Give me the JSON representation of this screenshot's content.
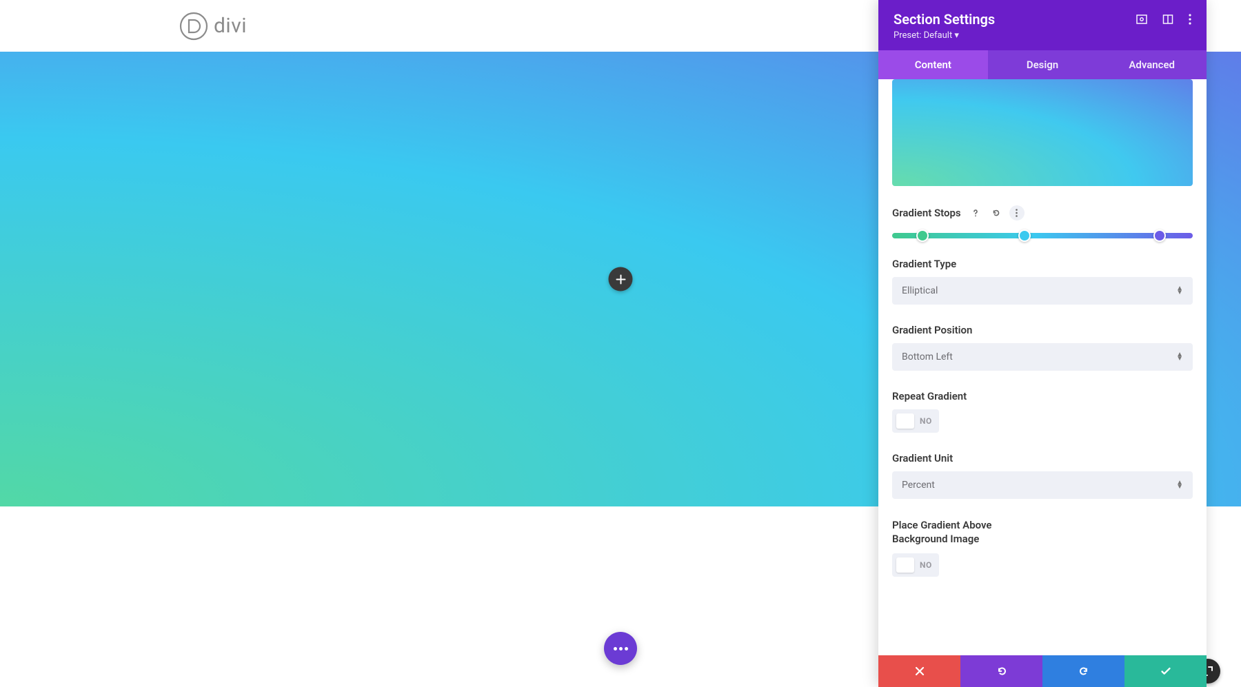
{
  "brand": {
    "name": "divi"
  },
  "panel": {
    "title": "Section Settings",
    "preset": "Preset: Default ▾",
    "tabs": {
      "content": "Content",
      "design": "Design",
      "advanced": "Advanced"
    },
    "gradient_stops": {
      "label": "Gradient Stops",
      "stops": [
        {
          "pos": 10,
          "color": "#3fc98e"
        },
        {
          "pos": 44,
          "color": "#3bc9ef"
        },
        {
          "pos": 89,
          "color": "#6c5ce7"
        }
      ]
    },
    "gradient_type": {
      "label": "Gradient Type",
      "value": "Elliptical"
    },
    "gradient_position": {
      "label": "Gradient Position",
      "value": "Bottom Left"
    },
    "repeat_gradient": {
      "label": "Repeat Gradient",
      "value": "NO"
    },
    "gradient_unit": {
      "label": "Gradient Unit",
      "value": "Percent"
    },
    "place_above": {
      "label": "Place Gradient Above Background Image",
      "value": "NO"
    }
  }
}
